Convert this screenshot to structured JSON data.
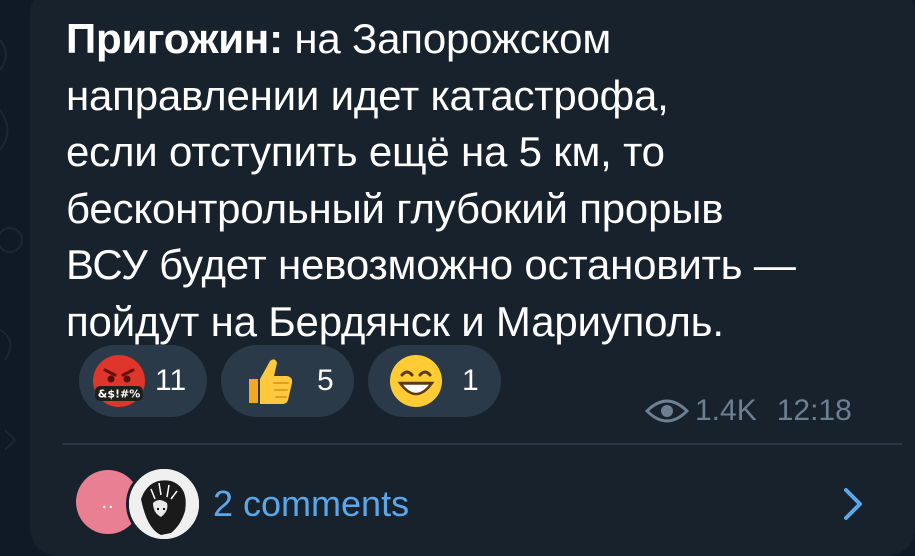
{
  "message": {
    "author": "Пригожин:",
    "text_lines": [
      " на Запорожском",
      "направлении идет катастрофа,",
      "если отступить ещё на 5 км, то",
      "бесконтрольный глубокий прорыв",
      "ВСУ будет невозможно остановить —",
      "пойдут на Бердянск и Мариуполь."
    ]
  },
  "reactions": [
    {
      "emoji": "angry-face-symbols-icon",
      "count": "11"
    },
    {
      "emoji": "thumbs-up-icon",
      "count": "5"
    },
    {
      "emoji": "grinning-face-icon",
      "count": "1"
    }
  ],
  "meta": {
    "views": "1.4K",
    "time": "12:18"
  },
  "comments": {
    "avatar_text": "..",
    "label": "2 comments"
  },
  "colors": {
    "background": "#0f1a26",
    "bubble": "#18222d",
    "reaction_pill": "#2b3a49",
    "link": "#5aa7ea",
    "meta": "#6e7f91"
  }
}
